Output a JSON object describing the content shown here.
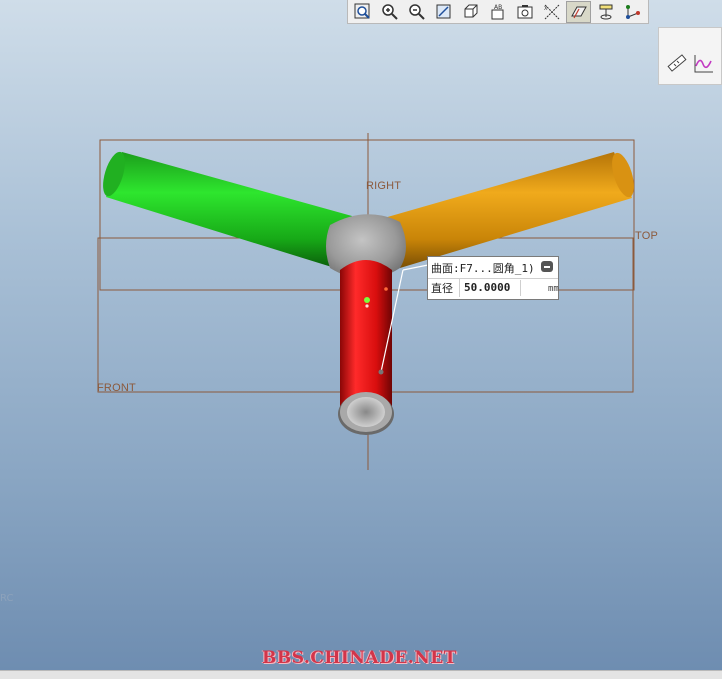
{
  "toolbar": {
    "items": [
      {
        "icon": "zoom-window-icon",
        "active": false
      },
      {
        "icon": "zoom-in-icon",
        "active": false
      },
      {
        "icon": "zoom-out-icon",
        "active": false
      },
      {
        "icon": "refit-icon",
        "active": false
      },
      {
        "icon": "display-style-icon",
        "active": false
      },
      {
        "icon": "named-views-icon",
        "active": false
      },
      {
        "icon": "saved-orientation-icon",
        "active": false
      },
      {
        "icon": "datum-axis-icon",
        "active": false
      },
      {
        "icon": "datum-plane-icon",
        "active": true
      },
      {
        "icon": "datum-point-icon",
        "active": false
      },
      {
        "icon": "datum-csys-icon",
        "active": false
      }
    ]
  },
  "side_panel": {
    "items": [
      "measure-icon",
      "analysis-graph-icon"
    ]
  },
  "planes": {
    "right": "RIGHT",
    "top": "TOP",
    "front": "FRONT"
  },
  "tooltip": {
    "title": "曲面:F7...圆角_1)",
    "label": "直径",
    "value": "50.0000",
    "unit": "mm"
  },
  "corner_text": "RC",
  "watermark": "BBS.CHINADE.NET",
  "colors": {
    "left_arm": "#1fcc1f",
    "right_arm": "#e09a10",
    "bottom_arm": "#e01010",
    "joint": "#9a9a9a",
    "plane_border": "#8c5a3c"
  }
}
